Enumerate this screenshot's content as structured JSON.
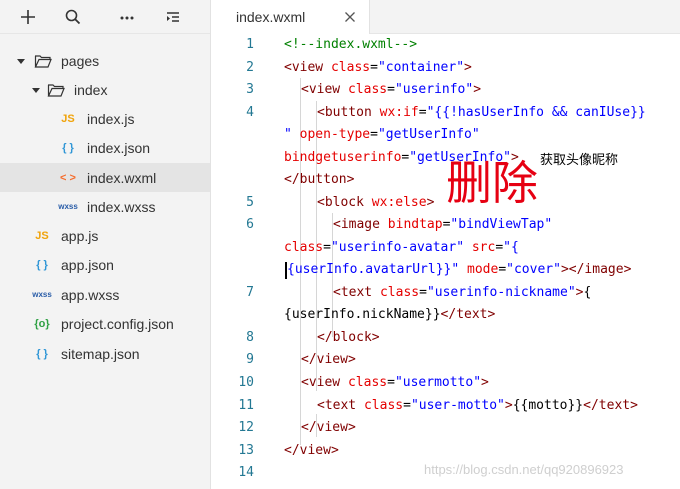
{
  "toolbar": {
    "icons": [
      "plus-icon",
      "search-icon",
      "more-icon",
      "collapse-icon"
    ]
  },
  "tree": [
    {
      "label": "pages",
      "type": "folder",
      "icon_text": ""
    },
    {
      "label": "index",
      "type": "folder",
      "icon_text": ""
    },
    {
      "label": "index.js",
      "type": "js",
      "icon_text": "JS"
    },
    {
      "label": "index.json",
      "type": "json",
      "icon_text": "{ }"
    },
    {
      "label": "index.wxml",
      "type": "wxml",
      "icon_text": "< >"
    },
    {
      "label": "index.wxss",
      "type": "wxss",
      "icon_text": "wxss"
    },
    {
      "label": "app.js",
      "type": "js",
      "icon_text": "JS"
    },
    {
      "label": "app.json",
      "type": "json",
      "icon_text": "{ }"
    },
    {
      "label": "app.wxss",
      "type": "wxss",
      "icon_text": "wxss"
    },
    {
      "label": "project.config.json",
      "type": "config",
      "icon_text": "{o}"
    },
    {
      "label": "sitemap.json",
      "type": "json",
      "icon_text": "{ }"
    }
  ],
  "tab": {
    "label": "index.wxml"
  },
  "line_numbers": [
    "1",
    "2",
    "3",
    "4",
    "5",
    "6",
    "7",
    "8",
    "9",
    "10",
    "11",
    "12",
    "13",
    "14"
  ],
  "code": {
    "l1": {
      "a": "<!--index.wxml-->"
    },
    "l2": {
      "a": "<view",
      "b": "class",
      "c": "=",
      "d": "\"container\"",
      "e": ">"
    },
    "l3": {
      "a": "<view",
      "b": "class",
      "c": "=",
      "d": "\"userinfo\"",
      "e": ">"
    },
    "l4": {
      "a": "<button",
      "b": "wx:if",
      "c": "=",
      "d": "\"{{!hasUserInfo && canIUse}}"
    },
    "l4b": {
      "d": "\"",
      "b": "open-type",
      "c": "=",
      "e": "\"getUserInfo\""
    },
    "l4c": {
      "b": "bindgetuserinfo",
      "c": "=",
      "d": "\"getUserInfo\"",
      "e": ">",
      "f": "获取头像昵称"
    },
    "l4d": {
      "a": "</button>"
    },
    "l5": {
      "a": "<block",
      "b": "wx:else",
      "e": ">"
    },
    "l6": {
      "a": "<image",
      "b": "bindtap",
      "c": "=",
      "d": "\"bindViewTap\""
    },
    "l6b": {
      "b": "class",
      "c": "=",
      "d": "\"userinfo-avatar\"",
      "b2": "src",
      "c2": "=",
      "d2": "\"{"
    },
    "l6c": {
      "d": "{userInfo.avatarUrl}}\"",
      "b": "mode",
      "c": "=",
      "d2": "\"cover\"",
      "e": "></image>"
    },
    "l7": {
      "a": "<text",
      "b": "class",
      "c": "=",
      "d": "\"userinfo-nickname\"",
      "e": ">",
      "f": "{"
    },
    "l7b": {
      "f": "{userInfo.nickName}}",
      "e": "</text>"
    },
    "l8": {
      "a": "</block>"
    },
    "l9": {
      "a": "</view>"
    },
    "l10": {
      "a": "<view",
      "b": "class",
      "c": "=",
      "d": "\"usermotto\"",
      "e": ">"
    },
    "l11": {
      "a": "<text",
      "b": "class",
      "c": "=",
      "d": "\"user-motto\"",
      "e": ">",
      "f": "{{motto}}",
      "g": "</text>"
    },
    "l12": {
      "a": "</view>"
    },
    "l13": {
      "a": "</view>"
    }
  },
  "annotation": {
    "delete_label": "删除"
  },
  "watermark": "https://blog.csdn.net/qq920896923",
  "colors": {
    "tag": "#800000",
    "attr": "#e50000",
    "string": "#0000ff",
    "comment": "#008000",
    "annotation": "#e60012",
    "js_icon": "#f0a30a",
    "json_icon": "#2f96d6",
    "wxml_icon": "#f56c2c",
    "wxss_icon": "#2a5da8",
    "config_icon": "#2ea043"
  }
}
